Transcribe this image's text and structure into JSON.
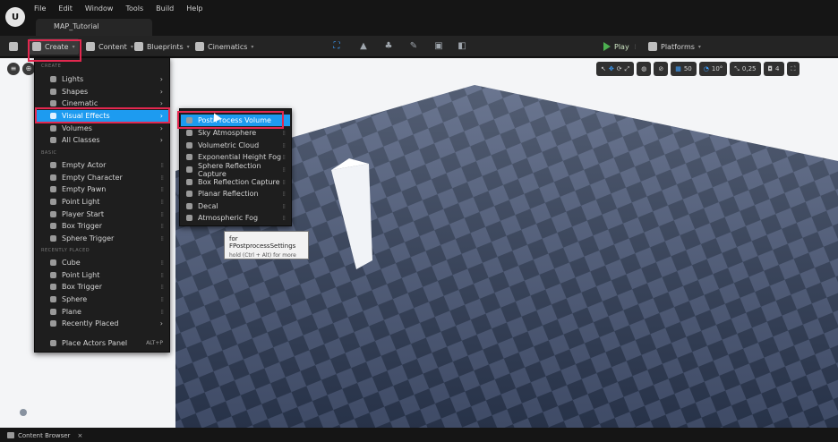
{
  "menubar": {
    "logo": "U",
    "items": [
      "File",
      "Edit",
      "Window",
      "Tools",
      "Build",
      "Help"
    ],
    "document_tab": "MAP_Tutorial"
  },
  "toolbar": {
    "create": "Create",
    "content": "Content",
    "blueprints": "Blueprints",
    "cinematics": "Cinematics",
    "play": "Play",
    "platforms": "Platforms"
  },
  "viewport": {
    "grid_snap": "50",
    "rotation_snap": "10°",
    "scale_snap": "0,25",
    "camera_speed": "4"
  },
  "create_menu": {
    "sections": {
      "create": "CREATE",
      "basic": "BASIC",
      "recent": "RECENTLY PLACED"
    },
    "create_items": [
      "Lights",
      "Shapes",
      "Cinematic",
      "Visual Effects",
      "Volumes",
      "All Classes"
    ],
    "basic_items": [
      "Empty Actor",
      "Empty Character",
      "Empty Pawn",
      "Point Light",
      "Player Start",
      "Box Trigger",
      "Sphere Trigger"
    ],
    "recent_items": [
      "Cube",
      "Point Light",
      "Box Trigger",
      "Sphere",
      "Plane",
      "Recently Placed"
    ],
    "footer_item": "Place Actors Panel",
    "footer_shortcut": "ALT+P"
  },
  "vfx_menu": {
    "items": [
      "Post Process Volume",
      "Sky Atmosphere",
      "Volumetric Cloud",
      "Exponential Height Fog",
      "Sphere Reflection Capture",
      "Box Reflection Capture",
      "Planar Reflection",
      "Decal",
      "Atmospheric Fog"
    ]
  },
  "tooltip": {
    "title": "for FPostprocessSettings",
    "hint": "hold (Ctrl + Alt) for more"
  },
  "bottom": {
    "content_browser": "Content Browser",
    "close": "×"
  },
  "colors": {
    "highlight_border": "#e2284f",
    "selection": "#1d9bf0",
    "floor_dark": "#2e3b55",
    "floor_light": "#4a5878"
  }
}
